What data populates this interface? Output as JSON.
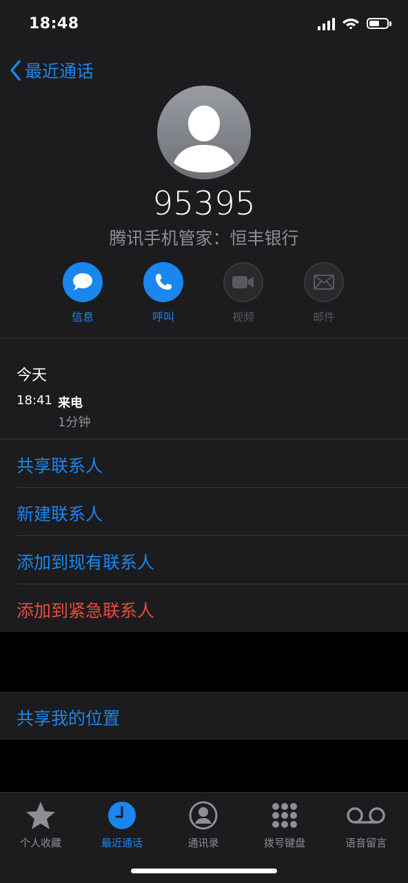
{
  "status_bar": {
    "time": "18:48"
  },
  "nav": {
    "back_label": "最近通话"
  },
  "contact": {
    "number": "95395",
    "subtitle": "腾讯手机管家：恒丰银行"
  },
  "actions": [
    {
      "label": "信息",
      "icon": "message-icon",
      "enabled": true
    },
    {
      "label": "呼叫",
      "icon": "phone-icon",
      "enabled": true
    },
    {
      "label": "视频",
      "icon": "video-icon",
      "enabled": false
    },
    {
      "label": "邮件",
      "icon": "mail-icon",
      "enabled": false
    }
  ],
  "history": {
    "day": "今天",
    "entries": [
      {
        "time": "18:41",
        "type": "来电",
        "duration": "1分钟"
      }
    ]
  },
  "menu": {
    "share_contact": "共享联系人",
    "new_contact": "新建联系人",
    "add_existing": "添加到现有联系人",
    "add_emergency": "添加到紧急联系人",
    "share_location": "共享我的位置"
  },
  "tabs": [
    {
      "label": "个人收藏",
      "icon": "star-icon",
      "active": false
    },
    {
      "label": "最近通话",
      "icon": "clock-icon",
      "active": true
    },
    {
      "label": "通讯录",
      "icon": "person-circle-icon",
      "active": false
    },
    {
      "label": "拨号键盘",
      "icon": "keypad-icon",
      "active": false
    },
    {
      "label": "语音留言",
      "icon": "voicemail-icon",
      "active": false
    }
  ],
  "colors": {
    "accent": "#1a86f0",
    "destructive": "#eb4a3e",
    "background": "#1c1c1e",
    "secondary_text": "#8e8e93"
  }
}
